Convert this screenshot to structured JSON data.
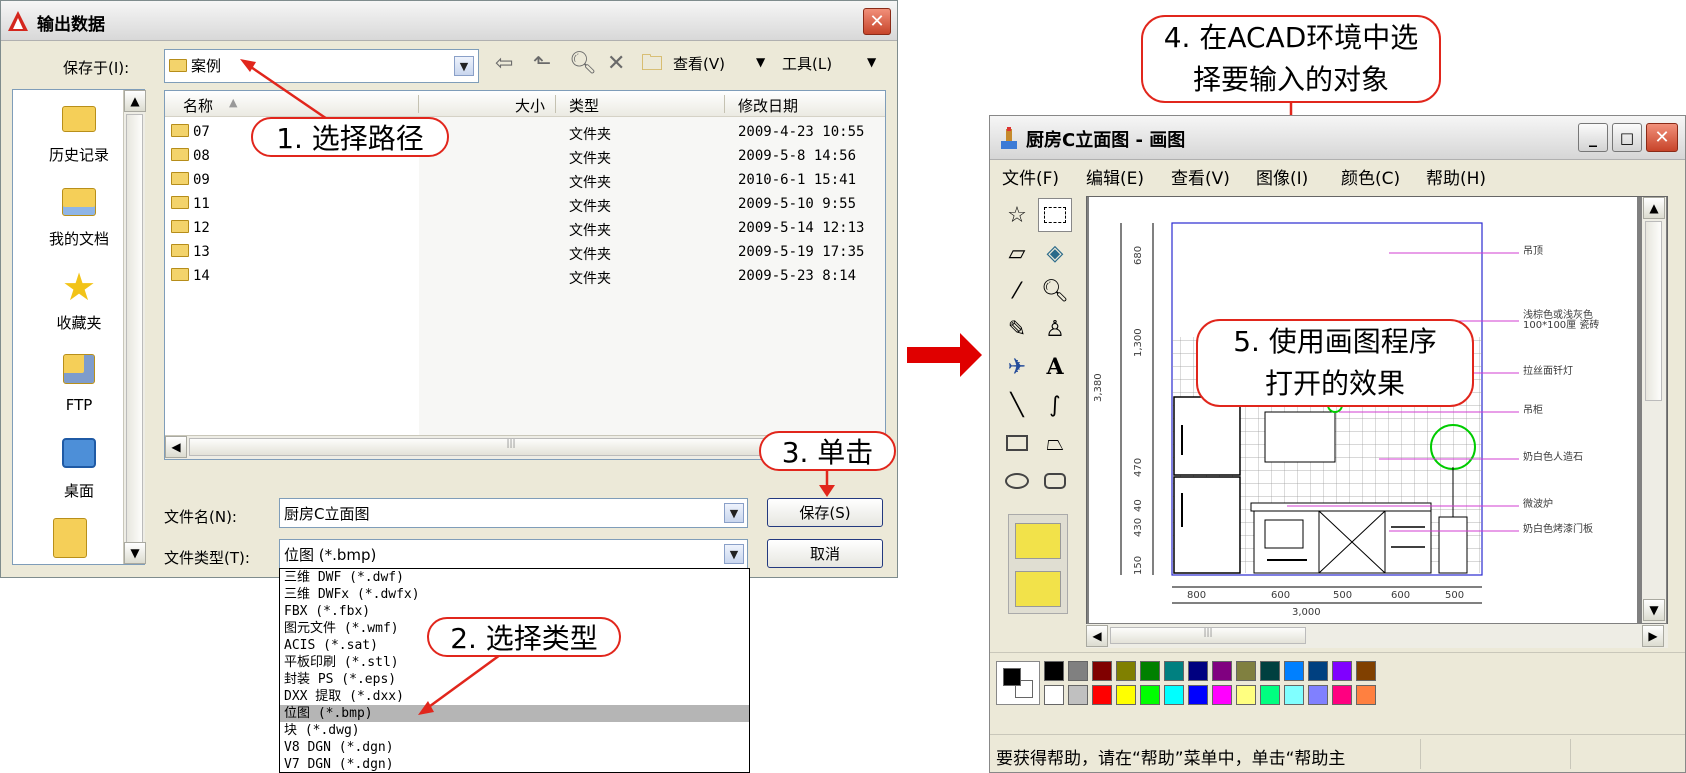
{
  "save_dialog": {
    "title": "输出数据",
    "save_in_label": "保存于(I):",
    "save_in_value": "案例",
    "view_menu": "查看(V)",
    "tools_menu": "工具(L)",
    "sidebar": [
      {
        "label": "历史记录",
        "icon": "history-folder-icon"
      },
      {
        "label": "我的文档",
        "icon": "my-documents-icon"
      },
      {
        "label": "收藏夹",
        "icon": "favorites-star-icon"
      },
      {
        "label": "FTP",
        "icon": "ftp-icon"
      },
      {
        "label": "桌面",
        "icon": "desktop-icon"
      }
    ],
    "columns": {
      "name": "名称",
      "size": "大小",
      "type": "类型",
      "modified": "修改日期"
    },
    "files": [
      {
        "name": "07",
        "type": "文件夹",
        "modified": "2009-4-23 10:55"
      },
      {
        "name": "08",
        "type": "文件夹",
        "modified": "2009-5-8 14:56"
      },
      {
        "name": "09",
        "type": "文件夹",
        "modified": "2010-6-1 15:41"
      },
      {
        "name": "11",
        "type": "文件夹",
        "modified": "2009-5-10 9:55"
      },
      {
        "name": "12",
        "type": "文件夹",
        "modified": "2009-5-14 12:13"
      },
      {
        "name": "13",
        "type": "文件夹",
        "modified": "2009-5-19 17:35"
      },
      {
        "name": "14",
        "type": "文件夹",
        "modified": "2009-5-23 8:14"
      }
    ],
    "filename_label": "文件名(N):",
    "filename_value": "厨房C立面图",
    "filetype_label": "文件类型(T):",
    "filetype_value": "位图 (*.bmp)",
    "save_button": "保存(S)",
    "cancel_button": "取消",
    "filetype_options": [
      "三维 DWF (*.dwf)",
      "三维 DWFx (*.dwfx)",
      "FBX (*.fbx)",
      "图元文件 (*.wmf)",
      "ACIS (*.sat)",
      "平板印刷 (*.stl)",
      "封装 PS (*.eps)",
      "DXX 提取 (*.dxx)",
      "位图 (*.bmp)",
      "块 (*.dwg)",
      "V8 DGN (*.dgn)",
      "V7 DGN (*.dgn)"
    ],
    "selected_option_index": 8
  },
  "callouts": {
    "c1": "1. 选择路径",
    "c2": "2. 选择类型",
    "c3": "3. 单击",
    "c4_line1": "4. 在ACAD环境中选",
    "c4_line2": "择要输入的对象",
    "c5_line1": "5. 使用画图程序",
    "c5_line2": "打开的效果"
  },
  "paint": {
    "title": "厨房C立面图 - 画图",
    "menu": [
      "文件(F)",
      "编辑(E)",
      "查看(V)",
      "图像(I)",
      "颜色(C)",
      "帮助(H)"
    ],
    "status": "要获得帮助，请在“帮助”菜单中，单击“帮助主",
    "palette_top": [
      "#000000",
      "#808080",
      "#800000",
      "#808000",
      "#008000",
      "#008080",
      "#000080",
      "#800080",
      "#808040",
      "#004040",
      "#0080ff",
      "#004080",
      "#8000ff",
      "#804000"
    ],
    "palette_bottom": [
      "#ffffff",
      "#c0c0c0",
      "#ff0000",
      "#ffff00",
      "#00ff00",
      "#00ffff",
      "#0000ff",
      "#ff00ff",
      "#ffff80",
      "#00ff80",
      "#80ffff",
      "#8080ff",
      "#ff0080",
      "#ff8040"
    ],
    "drawing": {
      "dims_vertical": [
        "680",
        "1,300",
        "470",
        "40",
        "430",
        "150"
      ],
      "total_height": "3,380",
      "dims_horizontal": [
        "800",
        "600",
        "500",
        "600",
        "500"
      ],
      "total_width": "3,000",
      "annotations": [
        "吊顶",
        "浅棕色或浅灰色 100*100厘 瓷砖",
        "拉丝面钎灯",
        "吊柜",
        "奶白色人造石",
        "微波炉",
        "奶白色烤漆门板"
      ]
    }
  }
}
